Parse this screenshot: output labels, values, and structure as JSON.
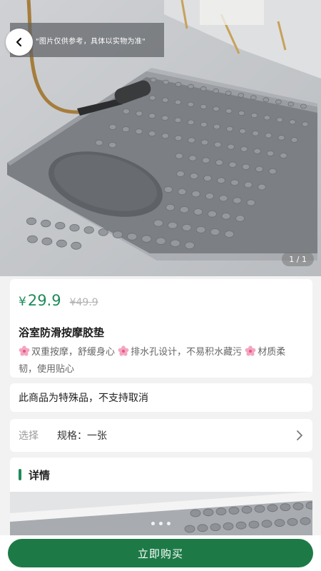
{
  "hero": {
    "disclaimer": "\"图片仅供参考，具体以实物为准\"",
    "image_counter": "1 / 1",
    "image_description_icon": "bath-mat-photo"
  },
  "product": {
    "currency_symbol": "¥",
    "price": "29.9",
    "original_price": "¥49.9",
    "title": "浴室防滑按摩胶垫",
    "features": [
      "双重按摩，舒缓身心 ",
      "排水孔设计，不易积水藏污 ",
      "材质柔韧，使用贴心"
    ],
    "feature_icon": "flower-icon"
  },
  "notice": {
    "text": "此商品为特殊品，不支持取消"
  },
  "spec": {
    "label": "选择",
    "value": "规格：一张",
    "icon": "chevron-right-icon"
  },
  "detail": {
    "heading": "详情"
  },
  "bottom": {
    "buy_label": "立即购买"
  },
  "colors": {
    "accent": "#1f8a5b",
    "buy_button": "#1d7a47",
    "mat": "#7c7f84"
  }
}
